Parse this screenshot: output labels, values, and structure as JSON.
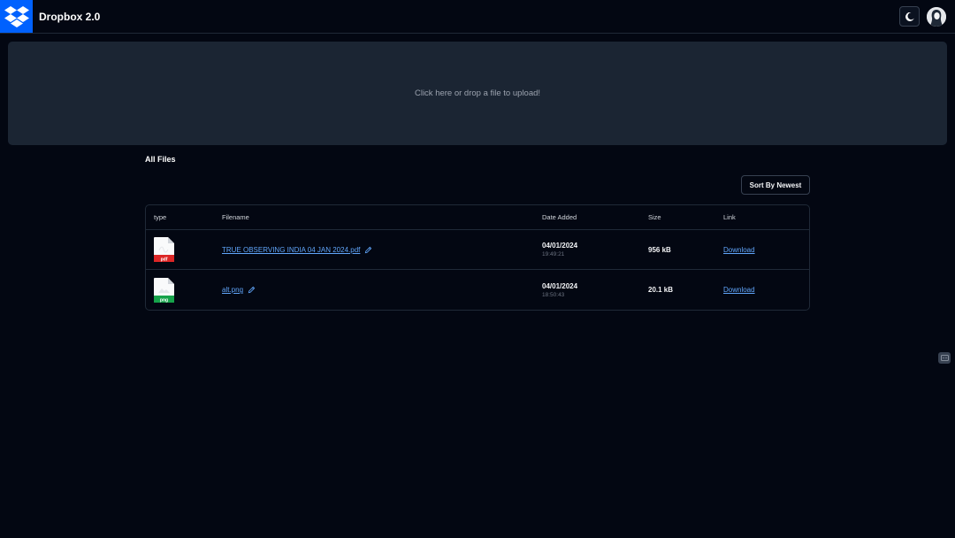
{
  "header": {
    "title": "Dropbox 2.0",
    "logo_icon": "dropbox-logo-icon",
    "theme_toggle_icon": "theme-toggle-icon",
    "avatar_icon": "user-avatar"
  },
  "upload": {
    "text": "Click here or drop a file to upload!"
  },
  "files_section": {
    "title": "All Files",
    "sort_label": "Sort By Newest"
  },
  "table": {
    "columns": [
      "type",
      "Filename",
      "Date Added",
      "Size",
      "Link"
    ],
    "rows": [
      {
        "type": "pdf",
        "type_color": "#dc2626",
        "filename": "TRUE OBSERVING INDIA 04 JAN 2024.pdf",
        "date": "04/01/2024",
        "time": "19:49:21",
        "size": "956 kB",
        "link": "Download"
      },
      {
        "type": "png",
        "type_color": "#16a34a",
        "filename": "alt.png",
        "date": "04/01/2024",
        "time": "18:50:43",
        "size": "20.1 kB",
        "link": "Download"
      }
    ]
  },
  "colors": {
    "background": "#030712",
    "accent": "#0061fe",
    "link": "#60a5fa",
    "dropzone": "#1b2533"
  }
}
